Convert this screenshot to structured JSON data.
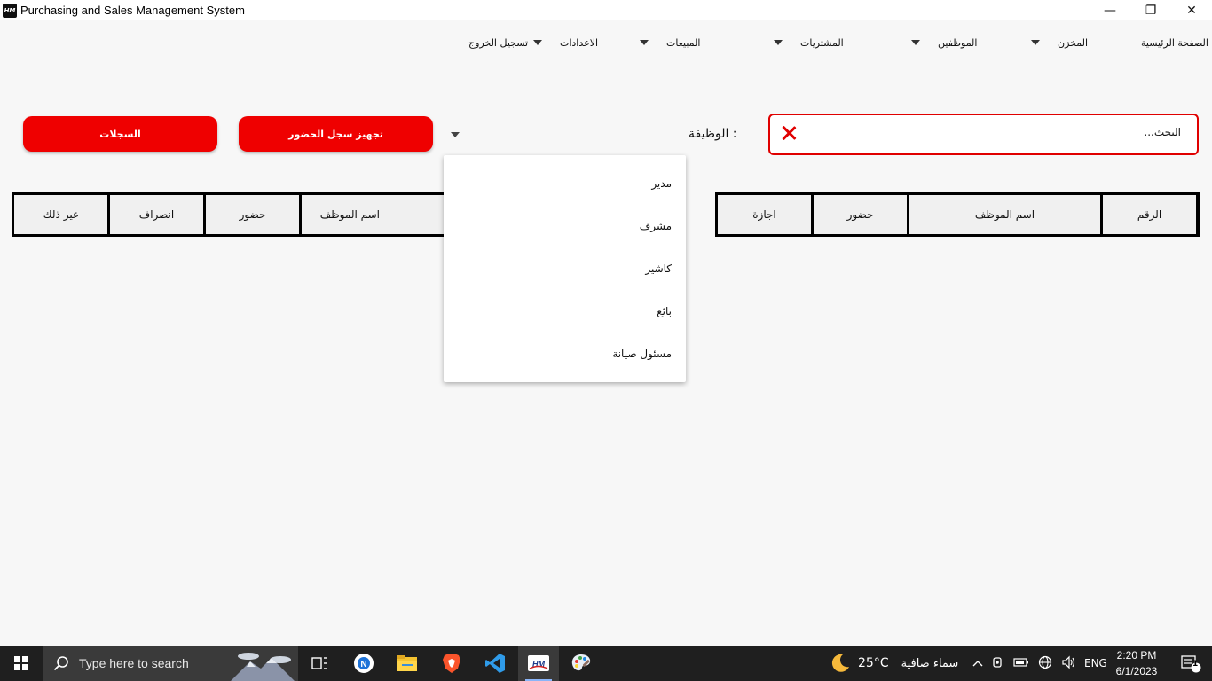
{
  "window": {
    "title": "Purchasing and Sales Management System",
    "app_icon_text": "HM",
    "minimize": "—",
    "restore": "❐",
    "close": "✕"
  },
  "menu": {
    "home": "الصفحة الرئيسية",
    "warehouse": "المخزن",
    "employees": "الموظفين",
    "purchases": "المشتريات",
    "sales": "المبيعات",
    "settings": "الاعدادات",
    "logout": "تسجيل الخروج"
  },
  "search": {
    "placeholder": "البحث..."
  },
  "filter": {
    "job_label": "الوظيفة :",
    "selected": ""
  },
  "buttons": {
    "prepare_attendance": "تجهيز سجل الحضور",
    "records": "السجلات"
  },
  "right_table": {
    "headers": [
      "الرقم",
      "اسم الموظف",
      "حضور",
      "اجازة"
    ]
  },
  "left_table": {
    "headers": [
      "اسم الموظف",
      "حضور",
      "انصراف",
      "غير ذلك"
    ]
  },
  "job_options": [
    "مدير",
    "مشرف",
    "كاشير",
    "بائع",
    "مسئول صيانة"
  ],
  "taskbar": {
    "search_placeholder": "Type here to search",
    "weather_temp": "25°C",
    "weather_text": "سماء صافية",
    "language": "ENG",
    "time": "2:20 PM",
    "date": "6/1/2023",
    "notification_count": "1"
  },
  "colors": {
    "accent_red": "#ef0000",
    "background": "#f7f7f7",
    "taskbar": "#1f1f1f"
  }
}
